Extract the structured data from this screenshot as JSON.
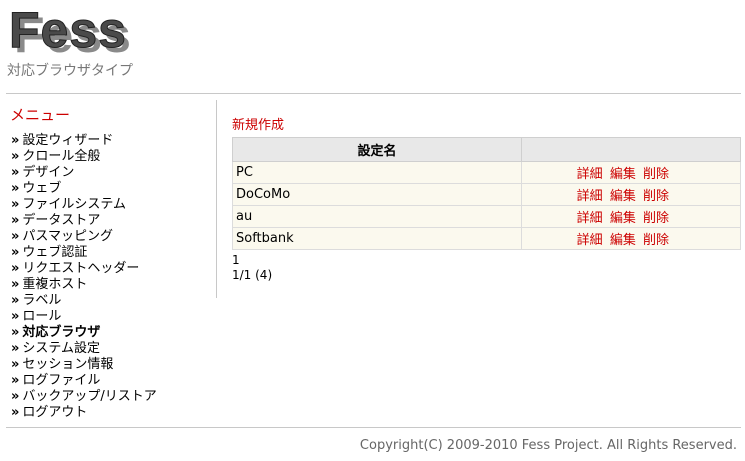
{
  "header": {
    "logo_text": "Fess",
    "subtitle": "対応ブラウザタイプ"
  },
  "sidebar": {
    "title": "メニュー",
    "bullet": "»",
    "items": [
      {
        "label": "設定ウィザード",
        "active": false
      },
      {
        "label": "クロール全般",
        "active": false
      },
      {
        "label": "デザイン",
        "active": false
      },
      {
        "label": "ウェブ",
        "active": false
      },
      {
        "label": "ファイルシステム",
        "active": false
      },
      {
        "label": "データストア",
        "active": false
      },
      {
        "label": "パスマッピング",
        "active": false
      },
      {
        "label": "ウェブ認証",
        "active": false
      },
      {
        "label": "リクエストヘッダー",
        "active": false
      },
      {
        "label": "重複ホスト",
        "active": false
      },
      {
        "label": "ラベル",
        "active": false
      },
      {
        "label": "ロール",
        "active": false
      },
      {
        "label": "対応ブラウザ",
        "active": true
      },
      {
        "label": "システム設定",
        "active": false
      },
      {
        "label": "セッション情報",
        "active": false
      },
      {
        "label": "ログファイル",
        "active": false
      },
      {
        "label": "バックアップ/リストア",
        "active": false
      },
      {
        "label": "ログアウト",
        "active": false
      }
    ]
  },
  "main": {
    "create_label": "新規作成",
    "table": {
      "header_name": "設定名",
      "header_actions": "",
      "rows": [
        {
          "name": "PC"
        },
        {
          "name": "DoCoMo"
        },
        {
          "name": "au"
        },
        {
          "name": "Softbank"
        }
      ],
      "action_labels": {
        "detail": "詳細",
        "edit": "編集",
        "delete": "削除"
      }
    },
    "pagination": {
      "page": "1",
      "info": "1/1 (4)"
    }
  },
  "footer": {
    "copyright": "Copyright(C) 2009-2010 Fess Project. All Rights Reserved."
  },
  "colors": {
    "accent": "#cc0000",
    "header_bg": "#e8e8e8",
    "row_bg": "#fbf9ee"
  }
}
